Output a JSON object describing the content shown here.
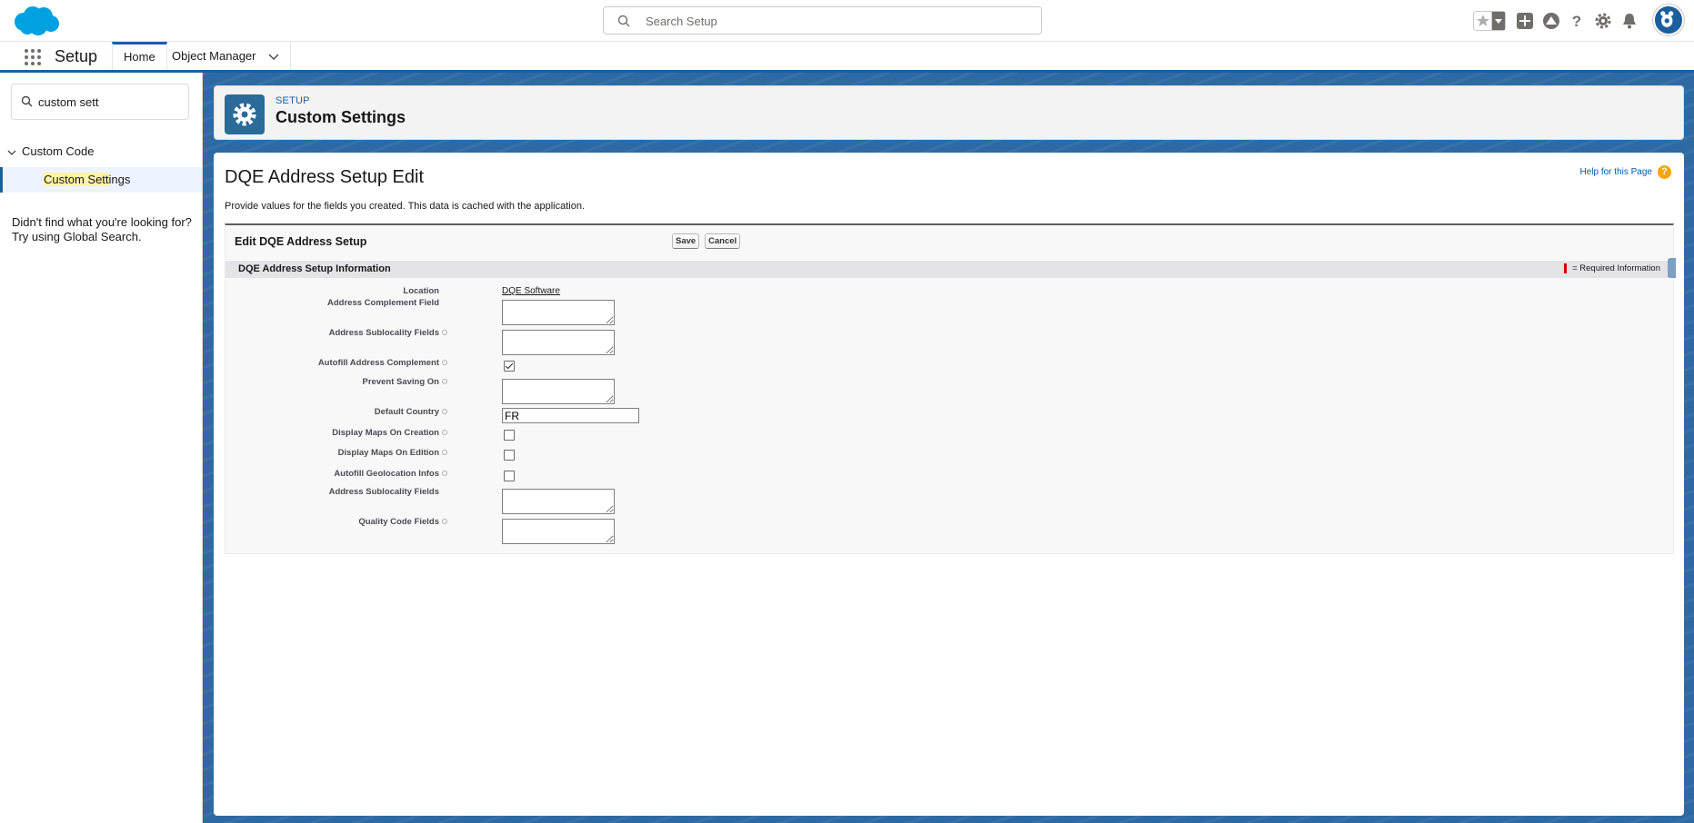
{
  "global_header": {
    "search_placeholder": "Search Setup"
  },
  "nav": {
    "app_name": "Setup",
    "tabs": [
      {
        "label": "Home",
        "active": true
      },
      {
        "label": "Object Manager",
        "active": false
      }
    ]
  },
  "sidebar": {
    "quick_find_value": "custom sett",
    "tree": {
      "node_label": "Custom Code",
      "leaf_label_highlight": "Custom Sett",
      "leaf_label_rest": "ings"
    },
    "not_found_line1": "Didn't find what you're looking for?",
    "not_found_line2": "Try using Global Search."
  },
  "page_header": {
    "eyebrow": "SETUP",
    "title": "Custom Settings"
  },
  "content": {
    "title": "DQE Address Setup Edit",
    "help_link": "Help for this Page",
    "description": "Provide values for the fields you created. This data is cached with the application.",
    "block_title": "Edit DQE Address Setup",
    "save_label": "Save",
    "cancel_label": "Cancel",
    "section_title": "DQE Address Setup Information",
    "required_info": "= Required Information"
  },
  "fields": [
    {
      "label": "Location",
      "type": "link",
      "value": "DQE Software"
    },
    {
      "label": "Address Complement Field",
      "type": "textarea",
      "value": ""
    },
    {
      "label": "Address Sublocality Fields",
      "type": "textarea",
      "value": ""
    },
    {
      "label": "Autofill Address Complement",
      "type": "checkbox",
      "checked": true
    },
    {
      "label": "Prevent Saving On",
      "type": "textarea",
      "value": ""
    },
    {
      "label": "Default Country",
      "type": "text",
      "value": "FR"
    },
    {
      "label": "Display Maps On Creation",
      "type": "checkbox",
      "checked": false
    },
    {
      "label": "Display Maps On Edition",
      "type": "checkbox",
      "checked": false
    },
    {
      "label": "Autofill Geolocation Infos",
      "type": "checkbox",
      "checked": false
    },
    {
      "label": "Address Sublocality Fields",
      "type": "textarea",
      "value": ""
    },
    {
      "label": "Quality Code Fields",
      "type": "textarea",
      "value": ""
    }
  ],
  "colors": {
    "brand": "#1b5f9e",
    "background_band": "#2d6aa4",
    "help_icon": "#f9a400",
    "required_bar": "#cc0000"
  },
  "icons": [
    "salesforce-cloud-logo",
    "search-icon",
    "star-icon",
    "add-icon",
    "trailhead-icon",
    "help-icon",
    "gear-icon",
    "bell-icon",
    "app-launcher-icon",
    "chevron-down-icon",
    "settings-gear-icon"
  ]
}
